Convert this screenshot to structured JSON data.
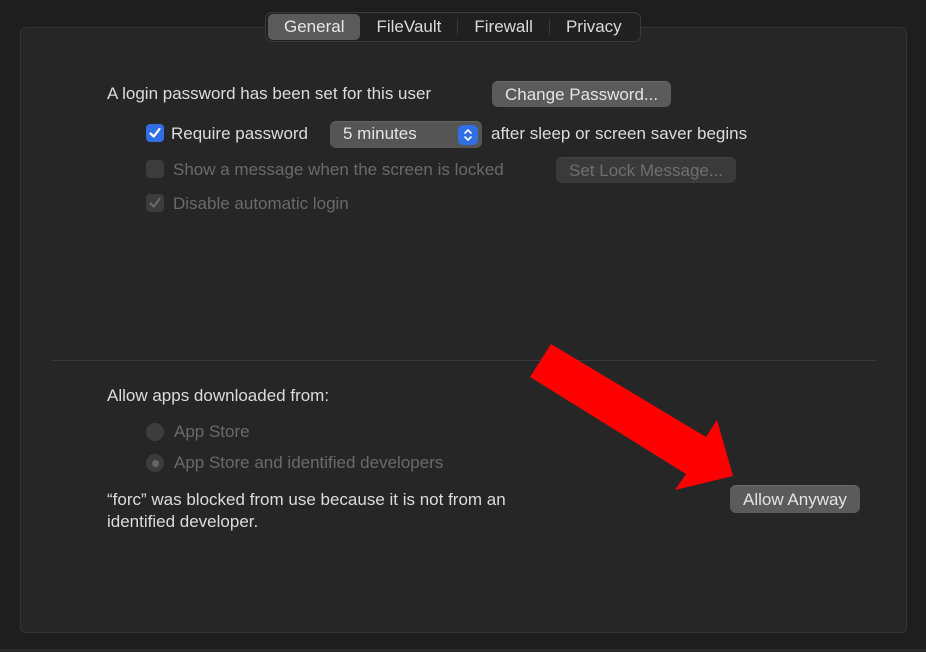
{
  "tabs": [
    {
      "label": "General",
      "active": true
    },
    {
      "label": "FileVault",
      "active": false
    },
    {
      "label": "Firewall",
      "active": false
    },
    {
      "label": "Privacy",
      "active": false
    }
  ],
  "general": {
    "password_label": "A login password has been set for this user",
    "change_password_button": "Change Password...",
    "require_password": {
      "label": "Require password",
      "checked": true,
      "selected": "5 minutes",
      "suffix": "after sleep or screen saver begins"
    },
    "show_message": {
      "label": "Show a message when the screen is locked",
      "checked": false,
      "disabled": true
    },
    "set_lock_message_button": "Set Lock Message...",
    "disable_auto_login": {
      "label": "Disable automatic login",
      "checked": true,
      "disabled": true
    }
  },
  "gatekeeper": {
    "heading": "Allow apps downloaded from:",
    "options": [
      {
        "label": "App Store",
        "selected": false,
        "disabled": true
      },
      {
        "label": "App Store and identified developers",
        "selected": true,
        "disabled": true
      }
    ],
    "blocked_message_line1": "“forc” was blocked from use because it is not from an",
    "blocked_message_line2": "identified developer.",
    "allow_anyway_button": "Allow Anyway"
  },
  "annotation": {
    "type": "arrow",
    "color": "#ff0000",
    "points_to": "Allow Anyway"
  },
  "colors": {
    "accent": "#2f6ee4",
    "background": "#262626"
  }
}
